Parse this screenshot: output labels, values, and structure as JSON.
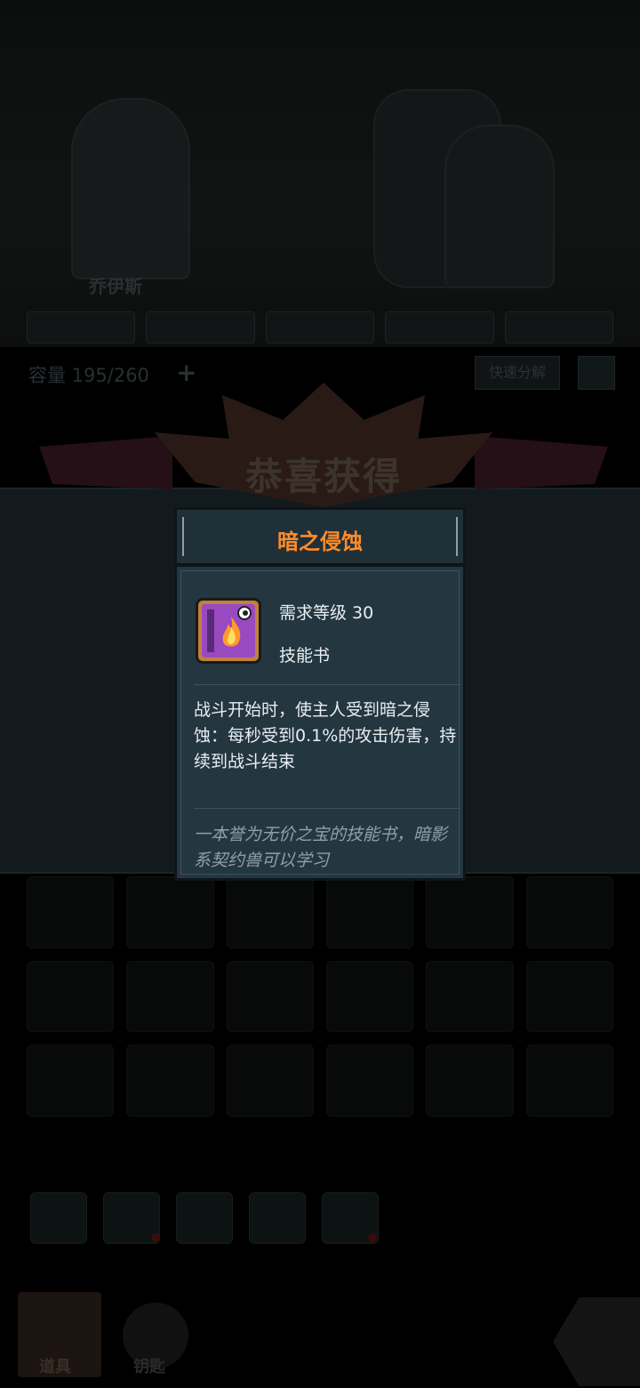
{
  "background": {
    "hero_name": "乔伊斯",
    "capacity": "容量 195/260",
    "plus": "+",
    "quick_decompose": "快速分解",
    "nav": {
      "item1": "道具",
      "item2": "钥匙"
    },
    "banner_title": "恭喜获得"
  },
  "popup": {
    "title": "暗之侵蚀",
    "required_level": "需求等级 30",
    "item_type": "技能书",
    "description": "战斗开始时，使主人受到暗之侵蚀：每秒受到0.1%的攻击伤害，持续到战斗结束",
    "flavor": "一本誉为无价之宝的技能书，暗影系契约兽可以学习",
    "icon": "skill-book-icon",
    "colors": {
      "title": "#ff8c2a",
      "panel": "#243640",
      "book": "#9a4ac0",
      "frame": "#c08040"
    }
  }
}
